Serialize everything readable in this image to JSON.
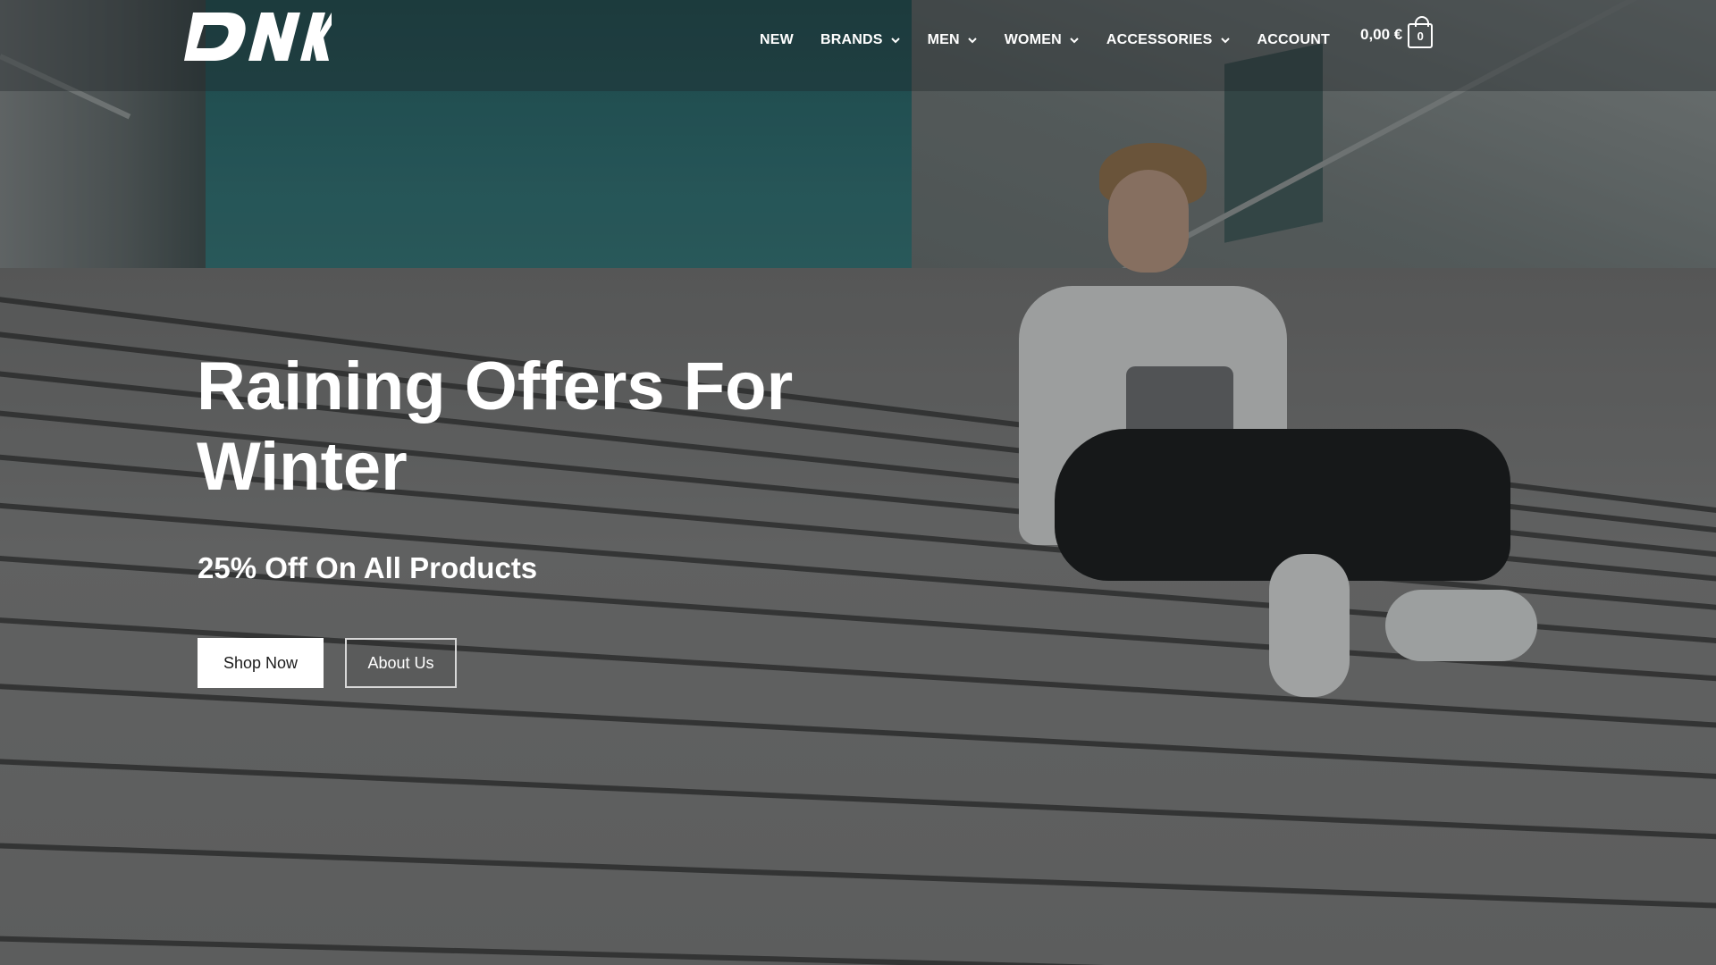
{
  "brand": {
    "logo_text": "DNK"
  },
  "nav": {
    "items": [
      {
        "label": "NEW",
        "has_dropdown": false
      },
      {
        "label": "BRANDS",
        "has_dropdown": true
      },
      {
        "label": "MEN",
        "has_dropdown": true
      },
      {
        "label": "WOMEN",
        "has_dropdown": true
      },
      {
        "label": "ACCESSORIES",
        "has_dropdown": true
      },
      {
        "label": "ACCOUNT",
        "has_dropdown": false
      }
    ],
    "chevron_icon": "chevron-down-icon"
  },
  "cart": {
    "total": "0,00 €",
    "count": "0",
    "icon": "shopping-bag-icon"
  },
  "hero": {
    "title": "Raining Offers For Winter",
    "subtitle": "25% Off On All Products",
    "primary_button": "Shop Now",
    "secondary_button": "About Us"
  },
  "colors": {
    "overlay": "#1c2022",
    "text": "#ffffff",
    "primary_button_bg": "#ffffff",
    "primary_button_text": "#1b1b1b"
  }
}
